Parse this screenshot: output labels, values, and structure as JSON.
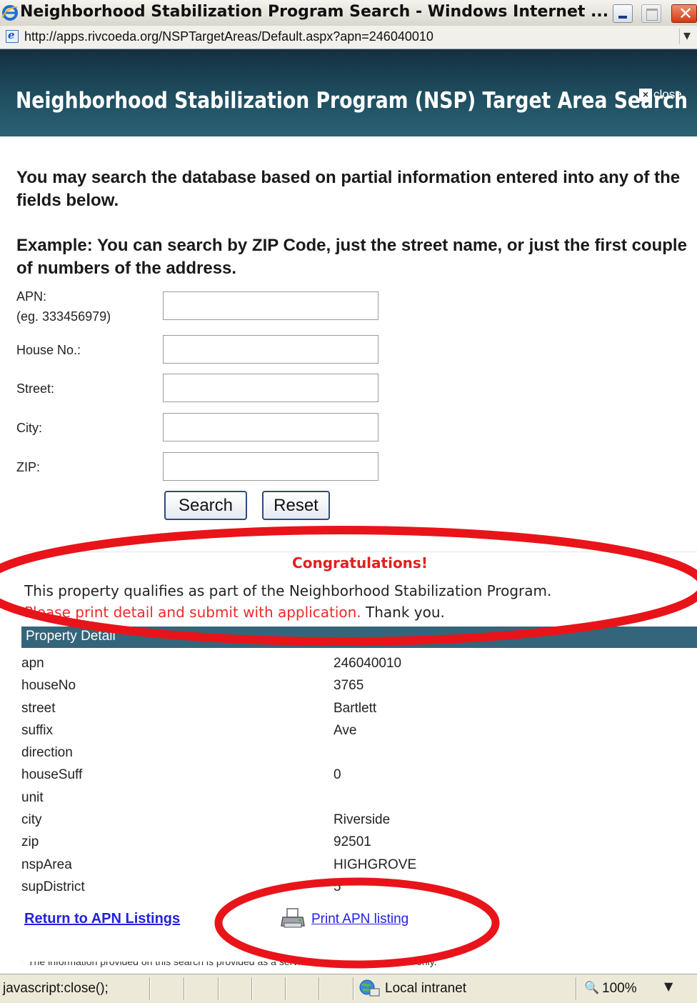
{
  "window": {
    "title": "Neighborhood Stabilization Program Search - Windows Internet ...",
    "url": "http://apps.rivcoeda.org/NSPTargetAreas/Default.aspx?apn=246040010"
  },
  "header": {
    "title": "Neighborhood Stabilization Program (NSP) Target Area Search",
    "close_label": "close"
  },
  "intro": {
    "line1": "You may search the database based on partial information entered into any of the fields below.",
    "line2": "Example: You can search by ZIP Code, just the street name, or just the first couple of numbers of the address."
  },
  "form": {
    "apn_label": "APN:",
    "apn_hint": "(eg. 333456979)",
    "apn_value": "",
    "house_label": "House No.:",
    "house_value": "",
    "street_label": "Street:",
    "street_value": "",
    "city_label": "City:",
    "city_value": "",
    "zip_label": "ZIP:",
    "zip_value": "",
    "search_button": "Search",
    "reset_button": "Reset"
  },
  "result": {
    "congrats": "Congratulations!",
    "qualifies": "This property qualifies as part of the Neighborhood Stabilization Program.",
    "print_instruction": "Please print detail and submit with application.",
    "thanks": "Thank you."
  },
  "detail": {
    "header": "Property Detail",
    "rows": [
      {
        "key": "apn",
        "value": "246040010"
      },
      {
        "key": "houseNo",
        "value": "3765"
      },
      {
        "key": "street",
        "value": "Bartlett"
      },
      {
        "key": "suffix",
        "value": "Ave"
      },
      {
        "key": "direction",
        "value": ""
      },
      {
        "key": "houseSuff",
        "value": "0"
      },
      {
        "key": "unit",
        "value": ""
      },
      {
        "key": "city",
        "value": "Riverside"
      },
      {
        "key": "zip",
        "value": "92501"
      },
      {
        "key": "nspArea",
        "value": "HIGHGROVE"
      },
      {
        "key": "supDistrict",
        "value": "5"
      }
    ]
  },
  "links": {
    "return": "Return to APN Listings",
    "print": "Print APN listing"
  },
  "disclaimer": "* The information provided on this search is provided as a service for general information only.",
  "statusbar": {
    "status_text": "javascript:close();",
    "zone": "Local intranet",
    "zoom": "100%"
  },
  "icons": {
    "browser": "ie-logo-icon",
    "minimize": "minimize-icon",
    "maximize": "maximize-icon",
    "close": "close-icon",
    "printer": "printer-icon",
    "zone": "globe-icon",
    "zoom": "zoom-icon"
  },
  "colors": {
    "header_bg": "#1f4f61",
    "detail_header_bg": "#35657a",
    "congrats_red": "#e02020",
    "link_blue": "#2222dd",
    "annotation_red": "#e8141a"
  }
}
